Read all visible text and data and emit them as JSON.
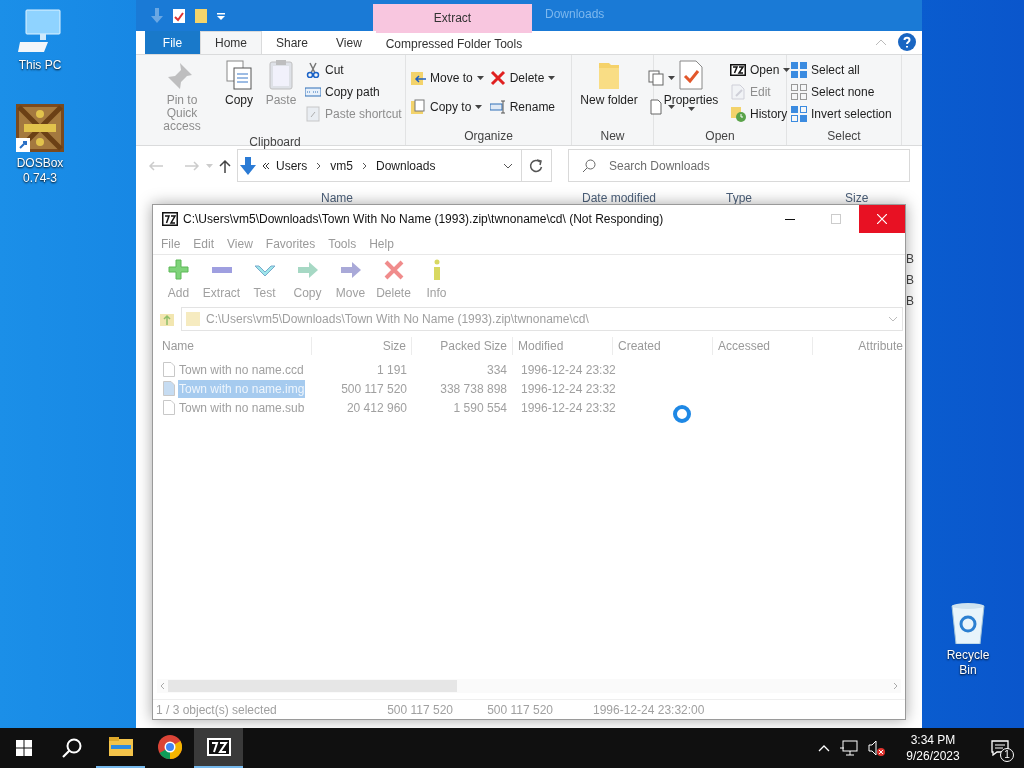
{
  "desktop_icons": [
    {
      "label": "This PC",
      "kind": "computer"
    },
    {
      "label": "DOSBox 0.74-3",
      "kind": "dosbox"
    },
    {
      "label": "Recycle Bin",
      "kind": "recycle"
    }
  ],
  "explorer": {
    "context_tab": "Extract",
    "title": "Downloads",
    "tabs": [
      {
        "label": "File",
        "kind": "file",
        "selected": false
      },
      {
        "label": "Home",
        "kind": "tab",
        "selected": true
      },
      {
        "label": "Share",
        "kind": "tab",
        "selected": false
      },
      {
        "label": "View",
        "kind": "tab",
        "selected": false
      },
      {
        "label": "Compressed Folder Tools",
        "kind": "context",
        "selected": false
      }
    ],
    "ribbon_groups": [
      {
        "label": "Clipboard",
        "items": [
          {
            "kind": "large",
            "label": "Pin to Quick access",
            "disabled": true
          },
          {
            "kind": "large",
            "label": "Copy",
            "disabled": false
          },
          {
            "kind": "large",
            "label": "Paste",
            "disabled": true
          },
          {
            "kind": "stack",
            "items": [
              {
                "label": "Cut",
                "disabled": false
              },
              {
                "label": "Copy path",
                "disabled": false
              },
              {
                "label": "Paste shortcut",
                "disabled": true
              }
            ]
          }
        ]
      },
      {
        "label": "Organize",
        "items": [
          {
            "kind": "stack",
            "items": [
              {
                "label": "Move to",
                "dropdown": true,
                "disabled": false
              },
              {
                "label": "Copy to",
                "dropdown": true,
                "disabled": false
              }
            ]
          },
          {
            "kind": "stack",
            "items": [
              {
                "label": "Delete",
                "dropdown": true,
                "disabled": false
              },
              {
                "label": "Rename",
                "disabled": false
              }
            ]
          }
        ]
      },
      {
        "label": "New",
        "items": [
          {
            "kind": "large",
            "label": "New folder",
            "disabled": false
          },
          {
            "kind": "stack",
            "items": [
              {
                "dropdown": true,
                "disabled": false
              },
              {
                "dropdown": true,
                "disabled": false
              }
            ]
          }
        ]
      },
      {
        "label": "Open",
        "items": [
          {
            "kind": "large",
            "label": "Properties",
            "dropdown": true,
            "disabled": false
          },
          {
            "kind": "stack",
            "items": [
              {
                "label": "Open",
                "dropdown": true,
                "disabled": false
              },
              {
                "label": "Edit",
                "disabled": true
              },
              {
                "label": "History",
                "disabled": false
              }
            ]
          }
        ]
      },
      {
        "label": "Select",
        "items": [
          {
            "kind": "stack",
            "items": [
              {
                "label": "Select all",
                "disabled": false
              },
              {
                "label": "Select none",
                "disabled": false
              },
              {
                "label": "Invert selection",
                "disabled": false
              }
            ]
          }
        ]
      }
    ],
    "breadcrumbs": [
      "Users",
      "vm5",
      "Downloads"
    ],
    "search_placeholder": "Search Downloads",
    "columns": [
      "Name",
      "Date modified",
      "Type",
      "Size"
    ],
    "size_fragments": [
      "B",
      "B",
      "B"
    ]
  },
  "archive_window": {
    "title": "C:\\Users\\vm5\\Downloads\\Town With No Name (1993).zip\\twnoname\\cd\\ (Not Responding)",
    "menu": [
      "File",
      "Edit",
      "View",
      "Favorites",
      "Tools",
      "Help"
    ],
    "toolbar": [
      "Add",
      "Extract",
      "Test",
      "Copy",
      "Move",
      "Delete",
      "Info"
    ],
    "path": "C:\\Users\\vm5\\Downloads\\Town With No Name (1993).zip\\twnoname\\cd\\",
    "columns": [
      "Name",
      "Size",
      "Packed Size",
      "Modified",
      "Created",
      "Accessed",
      "Attribute"
    ],
    "rows": [
      {
        "name": "Town with no name.ccd",
        "size": "1 191",
        "packed_size": "334",
        "modified": "1996-12-24 23:32",
        "selected": false
      },
      {
        "name": "Town with no name.img",
        "size": "500 117 520",
        "packed_size": "338 738 898",
        "modified": "1996-12-24 23:32",
        "selected": true
      },
      {
        "name": "Town with no name.sub",
        "size": "20 412 960",
        "packed_size": "1 590 554",
        "modified": "1996-12-24 23:32",
        "selected": false
      }
    ],
    "status": [
      "1 / 3 object(s) selected",
      "500 117 520",
      "500 117 520",
      "1996-12-24 23:32:00"
    ]
  },
  "taskbar": {
    "apps": [
      {
        "kind": "explorer",
        "running": true,
        "active": false
      },
      {
        "kind": "chrome",
        "running": false,
        "active": false
      },
      {
        "kind": "sevenzip",
        "running": true,
        "active": true
      }
    ],
    "time": "3:34 PM",
    "date": "9/26/2023",
    "notification_count": "1"
  }
}
